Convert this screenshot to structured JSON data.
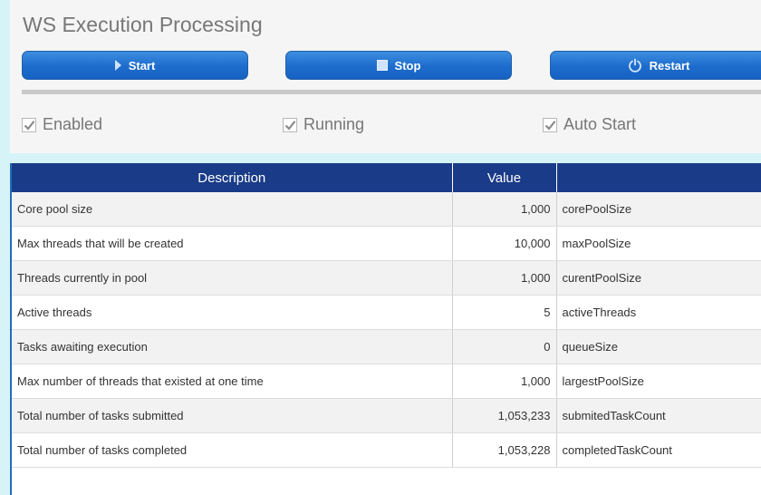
{
  "header": {
    "title": "WS Execution Processing"
  },
  "toolbar": {
    "start_label": "Start",
    "stop_label": "Stop",
    "restart_label": "Restart"
  },
  "options": [
    {
      "label": "Enabled",
      "checked": true
    },
    {
      "label": "Running",
      "checked": true
    },
    {
      "label": "Auto Start",
      "checked": true
    }
  ],
  "table": {
    "headers": [
      "Description",
      "Value",
      ""
    ],
    "rows": [
      {
        "description": "Core pool size",
        "value": "1,000",
        "key": "corePoolSize"
      },
      {
        "description": "Max threads that will be created",
        "value": "10,000",
        "key": "maxPoolSize"
      },
      {
        "description": "Threads currently in pool",
        "value": "1,000",
        "key": "curentPoolSize"
      },
      {
        "description": "Active threads",
        "value": "5",
        "key": "activeThreads"
      },
      {
        "description": "Tasks awaiting execution",
        "value": "0",
        "key": "queueSize"
      },
      {
        "description": "Max number of threads that existed at one time",
        "value": "1,000",
        "key": "largestPoolSize"
      },
      {
        "description": "Total number of tasks submitted",
        "value": "1,053,233",
        "key": "submitedTaskCount"
      },
      {
        "description": "Total number of tasks completed",
        "value": "1,053,228",
        "key": "completedTaskCount"
      }
    ]
  },
  "colors": {
    "header_bg": "#1a3b87",
    "button": "#1d6ccd",
    "accent": "#1f6fb8"
  },
  "icons": {
    "start": "play-icon",
    "stop": "stop-icon",
    "restart": "power-icon",
    "check": "check-icon"
  }
}
